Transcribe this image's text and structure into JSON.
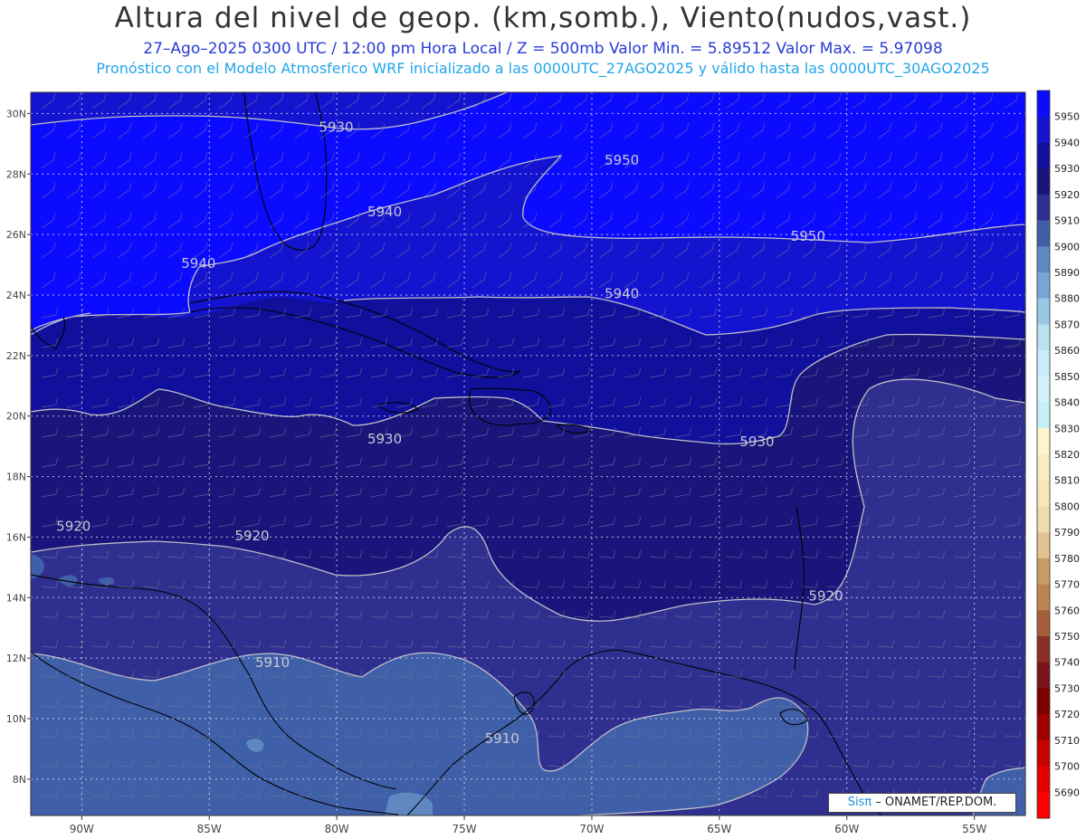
{
  "header": {
    "title": "Altura del nivel de geop. (km,somb.), Viento(nudos,vast.)",
    "subtitle1": "27–Ago–2025  0300 UTC / 12:00 pm Hora Local / Z = 500mb    Valor Min. = 5.89512  Valor Max. = 5.97098",
    "subtitle2": "Pronóstico con el Modelo Atmosferico WRF inicializado a las 0000UTC_27AGO2025 y válido hasta las  0000UTC_30AGO2025"
  },
  "map": {
    "lon_range": [
      -92,
      -53
    ],
    "lat_range": [
      6.8,
      30.7
    ],
    "lon_ticks": [
      "90W",
      "85W",
      "80W",
      "75W",
      "70W",
      "65W",
      "60W",
      "55W"
    ],
    "lon_values": [
      -90,
      -85,
      -80,
      -75,
      -70,
      -65,
      -60,
      -55
    ],
    "lat_ticks": [
      "30N",
      "28N",
      "26N",
      "24N",
      "22N",
      "20N",
      "18N",
      "16N",
      "14N",
      "12N",
      "10N",
      "8N"
    ],
    "lat_values": [
      30,
      28,
      26,
      24,
      22,
      20,
      18,
      16,
      14,
      12,
      10,
      8
    ],
    "contour_labels": [
      {
        "text": "5930",
        "lon": -80.7,
        "lat": 29.4
      },
      {
        "text": "5950",
        "lon": -69.5,
        "lat": 28.3
      },
      {
        "text": "5940",
        "lon": -78.8,
        "lat": 26.6
      },
      {
        "text": "5950",
        "lon": -62.2,
        "lat": 25.8
      },
      {
        "text": "5940",
        "lon": -86.1,
        "lat": 24.9
      },
      {
        "text": "5940",
        "lon": -69.5,
        "lat": 23.9
      },
      {
        "text": "5930",
        "lon": -78.8,
        "lat": 19.1
      },
      {
        "text": "5930",
        "lon": -64.2,
        "lat": 19.0
      },
      {
        "text": "5920",
        "lon": -91.0,
        "lat": 16.2
      },
      {
        "text": "5920",
        "lon": -84.0,
        "lat": 15.9
      },
      {
        "text": "5920",
        "lon": -61.5,
        "lat": 13.9
      },
      {
        "text": "5910",
        "lon": -83.2,
        "lat": 11.7
      },
      {
        "text": "5910",
        "lon": -74.2,
        "lat": 9.2
      }
    ]
  },
  "colorbar": {
    "labels": [
      "5950",
      "5940",
      "5930",
      "5920",
      "5910",
      "5900",
      "5890",
      "5880",
      "5870",
      "5860",
      "5850",
      "5840",
      "5830",
      "5820",
      "5810",
      "5800",
      "5790",
      "5780",
      "5770",
      "5760",
      "5750",
      "5740",
      "5730",
      "5720",
      "5710",
      "5700",
      "5690"
    ],
    "colors": [
      "#0b0bff",
      "#1414d0",
      "#10109c",
      "#1a157a",
      "#2f2f90",
      "#3f5fa8",
      "#5f88c2",
      "#7aa6d6",
      "#98c8e6",
      "#b8e2f2",
      "#c8ecf8",
      "#d4f2fb",
      "#c6f0f7",
      "#fff4cc",
      "#faebc0",
      "#f6e6b8",
      "#eedcac",
      "#e0c391",
      "#c89c64",
      "#bb8550",
      "#a55e3a",
      "#8a2e28",
      "#7a1418",
      "#7d0000",
      "#a00000",
      "#c80000",
      "#e60000",
      "#ff0000"
    ]
  },
  "field_colors": {
    "c5950": "#0b0bff",
    "c5940": "#1414d0",
    "c5930": "#10109c",
    "c5920": "#1a157a",
    "c5910": "#2f2f90",
    "c5900": "#3f5fa8",
    "c5890": "#5f88c2"
  },
  "credit": {
    "brand": "Sisπ",
    "org": " – ONAMET/REP.DOM."
  }
}
